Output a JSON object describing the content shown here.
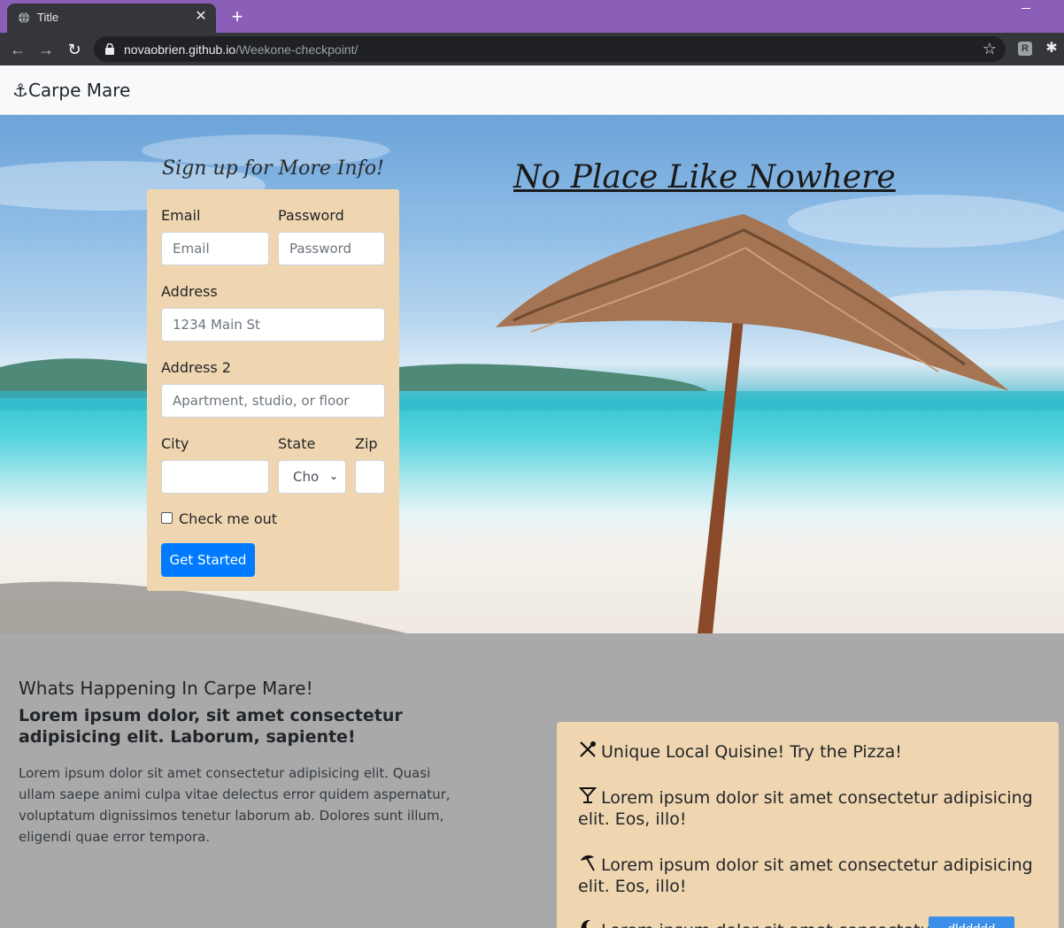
{
  "browser": {
    "tab_title": "Title",
    "url_host": "novaobrien.github.io",
    "url_path": "/Weekone-checkpoint/"
  },
  "navbar": {
    "brand_icon": "anchor-icon",
    "brand": "Carpe Mare"
  },
  "hero": {
    "signup_heading": "Sign up for More Info!",
    "title": "No Place Like Nowhere"
  },
  "form": {
    "email_label": "Email",
    "email_placeholder": "Email",
    "password_label": "Password",
    "password_placeholder": "Password",
    "address_label": "Address",
    "address_placeholder": "1234 Main St",
    "address2_label": "Address 2",
    "address2_placeholder": "Apartment, studio, or floor",
    "city_label": "City",
    "state_label": "State",
    "state_selected": "Cho",
    "zip_label": "Zip",
    "check_label": "Check me out",
    "submit_label": "Get Started"
  },
  "info": {
    "heading": "Whats Happening In Carpe Mare!",
    "subheading": "Lorem ipsum dolor, sit amet consectetur adipisicing elit. Laborum, sapiente!",
    "body": "Lorem ipsum dolor sit amet consectetur adipisicing elit. Quasi ullam saepe animi culpa vitae delectus error quidem aspernatur, voluptatum dignissimos tenetur laborum ab. Dolores sunt illum, eligendi quae error tempora."
  },
  "features": [
    {
      "icon": "utensils-icon",
      "text": "Unique Local Quisine! Try the Pizza!"
    },
    {
      "icon": "cocktail-icon",
      "text": "Lorem ipsum dolor sit amet consectetur adipisicing elit. Eos, illo!"
    },
    {
      "icon": "umbrella-beach-icon",
      "text": "Lorem ipsum dolor sit amet consectetur adipisicing elit. Eos, illo!"
    },
    {
      "icon": "moon-icon",
      "text": "Lorem ipsum dolor sit amet consectetur"
    }
  ],
  "features_button": "dlddddd",
  "colors": {
    "tab_strip": "#8b5fb7",
    "form_bg": "#f0d6b0",
    "primary": "#007bff",
    "section_bg": "#a9a9a9"
  }
}
